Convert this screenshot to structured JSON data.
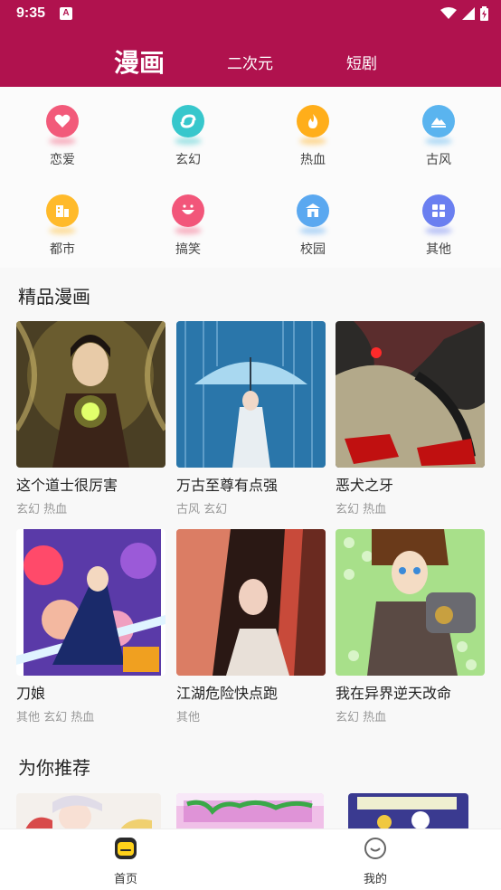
{
  "status": {
    "time": "9:35",
    "badge": "A"
  },
  "header": {
    "tabs": [
      {
        "label": "漫画"
      },
      {
        "label": "二次元"
      },
      {
        "label": "短剧"
      }
    ]
  },
  "categories": [
    {
      "label": "恋爱",
      "icon": "heart-icon",
      "color": "#f25a7a"
    },
    {
      "label": "玄幻",
      "icon": "swirl-icon",
      "color": "#37c7cc"
    },
    {
      "label": "热血",
      "icon": "flame-icon",
      "color": "#ffae1a"
    },
    {
      "label": "古风",
      "icon": "mountain-icon",
      "color": "#5ab4ef"
    },
    {
      "label": "都市",
      "icon": "building-icon",
      "color": "#ffba2a"
    },
    {
      "label": "搞笑",
      "icon": "smile-icon",
      "color": "#f2567a"
    },
    {
      "label": "校园",
      "icon": "school-icon",
      "color": "#5aa8f0"
    },
    {
      "label": "其他",
      "icon": "grid-icon",
      "color": "#6a7ff0"
    }
  ],
  "featured": {
    "title": "精品漫画",
    "items": [
      {
        "title": "这个道士很厉害",
        "tags": "玄幻 热血"
      },
      {
        "title": "万古至尊有点强",
        "tags": "古风 玄幻"
      },
      {
        "title": "恶犬之牙",
        "tags": "玄幻 热血"
      },
      {
        "title": "刀娘",
        "tags": "其他 玄幻 热血"
      },
      {
        "title": "江湖危险快点跑",
        "tags": "其他"
      },
      {
        "title": "我在异界逆天改命",
        "tags": "玄幻 热血"
      }
    ]
  },
  "recommend": {
    "title": "为你推荐"
  },
  "bottom_nav": [
    {
      "label": "首页",
      "icon": "home-icon"
    },
    {
      "label": "我的",
      "icon": "profile-icon"
    }
  ],
  "colors": {
    "brand": "#b0124e"
  }
}
